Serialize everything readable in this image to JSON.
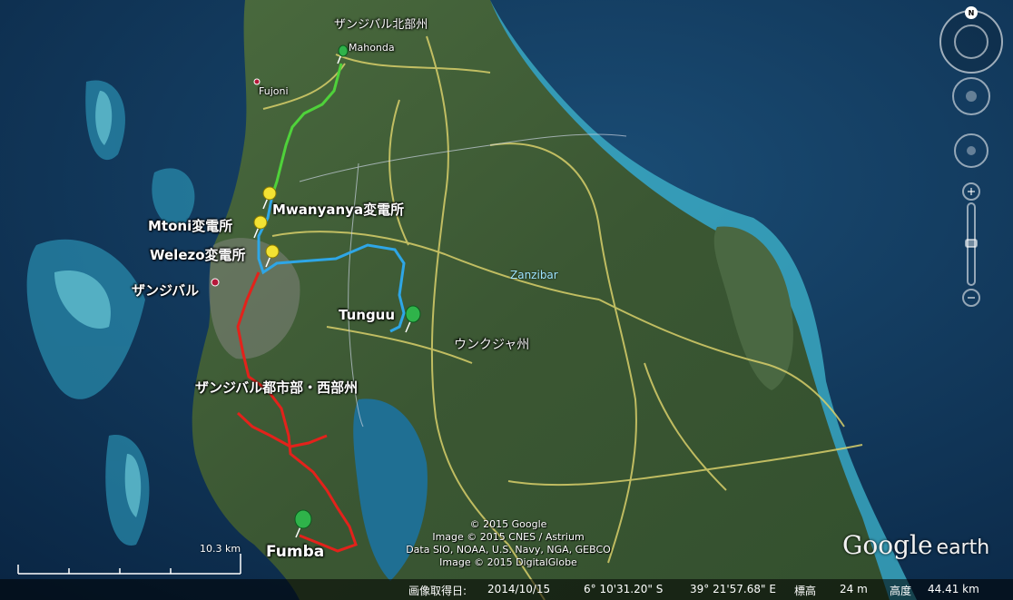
{
  "labels": {
    "region_north": "ザンジバル北部州",
    "mahonda": "Mahonda",
    "fujoni": "Fujoni",
    "mwanyanya": "Mwanyanya変電所",
    "mtoni": "Mtoni変電所",
    "welezo": "Welezo変電所",
    "zanzibar_jp": "ザンジバル",
    "zanzibar_en": "Zanzibar",
    "tunguu": "Tunguu",
    "unguja": "ウンクジャ州",
    "region_urban_west": "ザンジバル都市部・西部州",
    "fumba": "Fumba"
  },
  "credits": {
    "line1": "© 2015 Google",
    "line2": "Image © 2015 CNES / Astrium",
    "line3": "Data SIO, NOAA, U.S. Navy, NGA, GEBCO",
    "line4": "Image © 2015 DigitalGlobe"
  },
  "scale": {
    "label": "10.3 km"
  },
  "status": {
    "date_label": "画像取得日:",
    "date": "2014/10/15",
    "lat": "6° 10'31.20\" S",
    "lon": "39° 21'57.68\" E",
    "elev_label": "標高",
    "elev": "24 m",
    "alt_label": "高度",
    "alt": "44.41 km"
  },
  "logo": {
    "main": "Google",
    "sub": "earth"
  },
  "compass": {
    "north": "N"
  },
  "colors": {
    "ocean": "#0d3a5e",
    "reef": "#4fc7d8",
    "land": "#3f5a36",
    "roads": "#d8cf6a",
    "line_red": "#e3221b",
    "line_blue": "#2ea6e6",
    "line_green": "#4fd23a",
    "pin_yellow": "#f3e233",
    "pin_green": "#2fb34a"
  }
}
